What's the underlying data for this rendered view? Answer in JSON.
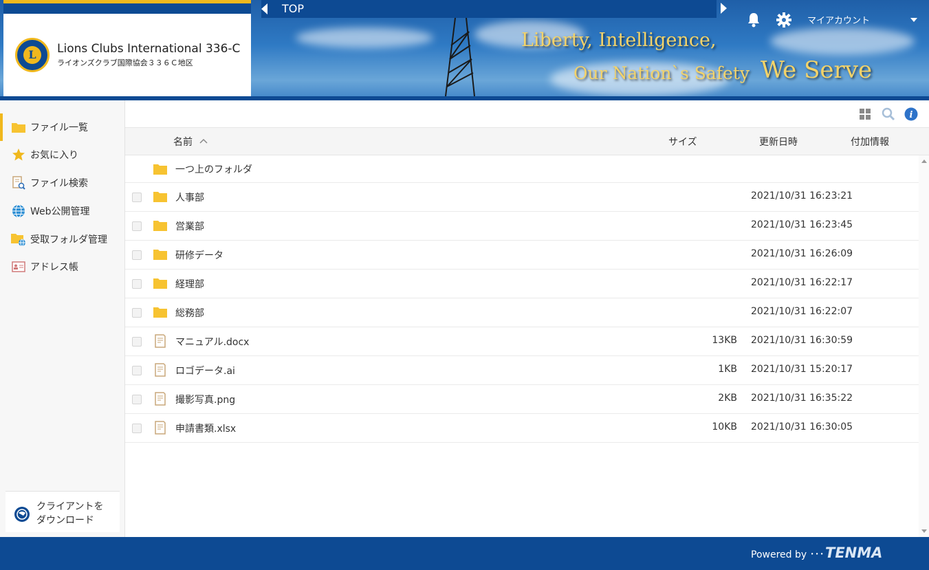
{
  "header": {
    "logo_title": "Lions Clubs International 336-C",
    "logo_subtitle": "ライオンズクラブ国際協会３３６Ｃ地区",
    "logo_letter": "L",
    "breadcrumb": "TOP",
    "account_label": "マイアカウント",
    "slogan_line1": "Liberty, Intelligence,",
    "slogan_line2": "Our Nation`s Safety",
    "slogan_motto": "We Serve"
  },
  "sidebar": {
    "items": [
      {
        "label": "ファイル一覧",
        "icon": "folder-icon"
      },
      {
        "label": "お気に入り",
        "icon": "star-icon"
      },
      {
        "label": "ファイル検索",
        "icon": "file-search-icon"
      },
      {
        "label": "Web公開管理",
        "icon": "globe-icon"
      },
      {
        "label": "受取フォルダ管理",
        "icon": "receive-folder-icon"
      },
      {
        "label": "アドレス帳",
        "icon": "address-book-icon"
      }
    ],
    "download_line1": "クライアントを",
    "download_line2": "ダウンロード"
  },
  "table": {
    "columns": {
      "name": "名前",
      "size": "サイズ",
      "updated": "更新日時",
      "extra": "付加情報"
    },
    "up_folder": "一つ上のフォルダ",
    "rows": [
      {
        "type": "folder",
        "name": "人事部",
        "size": "",
        "updated": "2021/10/31 16:23:21"
      },
      {
        "type": "folder",
        "name": "営業部",
        "size": "",
        "updated": "2021/10/31 16:23:45"
      },
      {
        "type": "folder",
        "name": "研修データ",
        "size": "",
        "updated": "2021/10/31 16:26:09"
      },
      {
        "type": "folder",
        "name": "経理部",
        "size": "",
        "updated": "2021/10/31 16:22:17"
      },
      {
        "type": "folder",
        "name": "総務部",
        "size": "",
        "updated": "2021/10/31 16:22:07"
      },
      {
        "type": "file",
        "name": "マニュアル.docx",
        "size": "13KB",
        "updated": "2021/10/31 16:30:59"
      },
      {
        "type": "file",
        "name": "ロゴデータ.ai",
        "size": "1KB",
        "updated": "2021/10/31 15:20:17"
      },
      {
        "type": "file",
        "name": "撮影写真.png",
        "size": "2KB",
        "updated": "2021/10/31 16:35:22"
      },
      {
        "type": "file",
        "name": "申請書類.xlsx",
        "size": "10KB",
        "updated": "2021/10/31 16:30:05"
      }
    ]
  },
  "footer": {
    "powered_by": "Powered by ･･･",
    "brand": "TENMA"
  },
  "colors": {
    "brand_blue": "#0d4a93",
    "accent_gold": "#f0b81d",
    "folder_yellow": "#f7c331"
  }
}
